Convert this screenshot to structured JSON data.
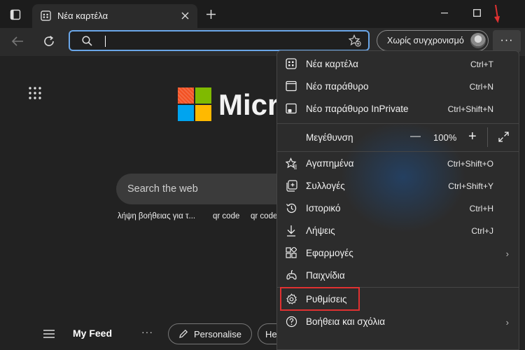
{
  "titlebar": {
    "tab_title": "Νέα καρτέλα"
  },
  "toolbar": {
    "sync_label": "Χωρίς συγχρονισμό",
    "more_label": "···"
  },
  "page": {
    "logo_text": "Micro",
    "search_placeholder": "Search the web",
    "suggestions": [
      "λήψη βοήθειας για τ...",
      "qr code",
      "qr code"
    ],
    "feed_label": "My Feed",
    "feed_more": "···",
    "personalise_label": "Personalise",
    "help_pill_label": "He"
  },
  "menu": {
    "new_tab": {
      "label": "Νέα καρτέλα",
      "shortcut": "Ctrl+T"
    },
    "new_window": {
      "label": "Νέο παράθυρο",
      "shortcut": "Ctrl+N"
    },
    "new_inprivate": {
      "label": "Νέο παράθυρο InPrivate",
      "shortcut": "Ctrl+Shift+N"
    },
    "zoom": {
      "label": "Μεγέθυνση",
      "minus": "—",
      "value": "100%",
      "plus": "+"
    },
    "favorites": {
      "label": "Αγαπημένα",
      "shortcut": "Ctrl+Shift+O"
    },
    "collections": {
      "label": "Συλλογές",
      "shortcut": "Ctrl+Shift+Y"
    },
    "history": {
      "label": "Ιστορικό",
      "shortcut": "Ctrl+H"
    },
    "downloads": {
      "label": "Λήψεις",
      "shortcut": "Ctrl+J"
    },
    "apps": {
      "label": "Εφαρμογές",
      "chevron": "›"
    },
    "games": {
      "label": "Παιχνίδια"
    },
    "settings": {
      "label": "Ρυθμίσεις"
    },
    "help": {
      "label": "Βοήθεια και σχόλια",
      "chevron": "›"
    }
  },
  "colors": {
    "accent": "#6aa6e8",
    "highlight": "#e03131",
    "ms_red": "#f25022",
    "ms_green": "#7fba00",
    "ms_blue": "#00a4ef",
    "ms_yellow": "#ffb900"
  }
}
